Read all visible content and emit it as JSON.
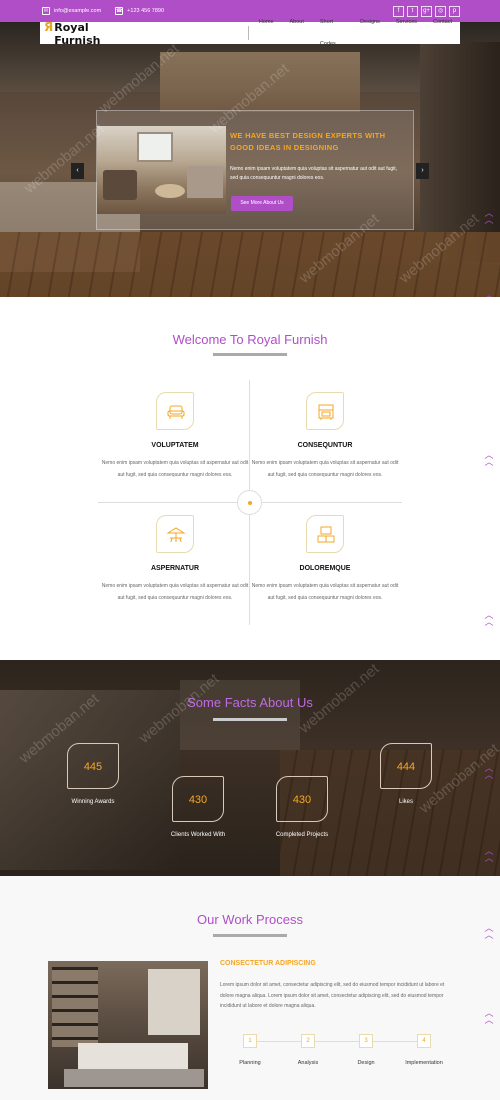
{
  "topbar": {
    "email": "info@example.com",
    "phone": "+123 456 7890",
    "socials": [
      {
        "icon": "facebook-icon",
        "glyph": "f"
      },
      {
        "icon": "twitter-icon",
        "glyph": "t"
      },
      {
        "icon": "google-plus-icon",
        "glyph": "g+"
      },
      {
        "icon": "dribbble-icon",
        "glyph": "◎"
      },
      {
        "icon": "pinterest-icon",
        "glyph": "p"
      }
    ]
  },
  "nav": {
    "logo_mark": "Я",
    "logo_text": "Royal Furnish",
    "items": [
      "Home",
      "About",
      "Short Codes",
      "Designs",
      "Services",
      "Contact"
    ]
  },
  "hero": {
    "title": "WE HAVE BEST DESIGN EXPERTS WITH GOOD IDEAS IN DESIGNING",
    "text": "Nemo enim ipsam voluptatem quia voluptas sit aspernatur aut odit aut fugit, sed quia consequuntur magni dolores eos.",
    "button": "See More About Us",
    "prev": "‹",
    "next": "›",
    "watermark": "webmoban.net"
  },
  "welcome": {
    "title": "Welcome To Royal Furnish",
    "features": [
      {
        "title": "VOLUPTATEM",
        "icon": "armchair-icon",
        "text": "Nemo enim ipsam voluptatem quia voluptas sit aspernatur aut odit aut fugit, sed quia consequuntur magni dolores eos."
      },
      {
        "title": "CONSEQUNTUR",
        "icon": "cabinet-icon",
        "text": "Nemo enim ipsam voluptatem quia voluptas sit aspernatur aut odit aut fugit, sed quia consequuntur magni dolores eos."
      },
      {
        "title": "ASPERNATUR",
        "icon": "patio-umbrella-icon",
        "text": "Nemo enim ipsam voluptatem quia voluptas sit aspernatur aut odit aut fugit, sed quia consequuntur magni dolores eos."
      },
      {
        "title": "DOLOREMQUE",
        "icon": "tv-stand-icon",
        "text": "Nemo enim ipsam voluptatem quia voluptas sit aspernatur aut odit aut fugit, sed quia consequuntur magni dolores eos."
      }
    ]
  },
  "facts": {
    "title": "Some Facts About Us",
    "items": [
      {
        "value": "445",
        "label": "Winning Awards"
      },
      {
        "value": "430",
        "label": "Clients Worked With"
      },
      {
        "value": "430",
        "label": "Completed Projects"
      },
      {
        "value": "444",
        "label": "Likes"
      }
    ]
  },
  "process": {
    "title": "Our Work Process",
    "heading": "CONSECTETUR ADIPISCING",
    "text": "Lorem ipsum dolor sit amet, consectetur adipiscing elit, sed do eiusmod tempor incididunt ut labore et dolore magna aliqua. Lorem ipsum dolor sit amet, consectetur adipiscing elit, sed do eiusmod tempor incididunt ut labore et dolore magna aliqua.",
    "steps": [
      {
        "num": "1",
        "label": "Planning"
      },
      {
        "num": "2",
        "label": "Analysis"
      },
      {
        "num": "3",
        "label": "Design"
      },
      {
        "num": "4",
        "label": "Implementation"
      }
    ]
  },
  "colors": {
    "accent": "#b04ec8",
    "highlight": "#f6a623"
  }
}
